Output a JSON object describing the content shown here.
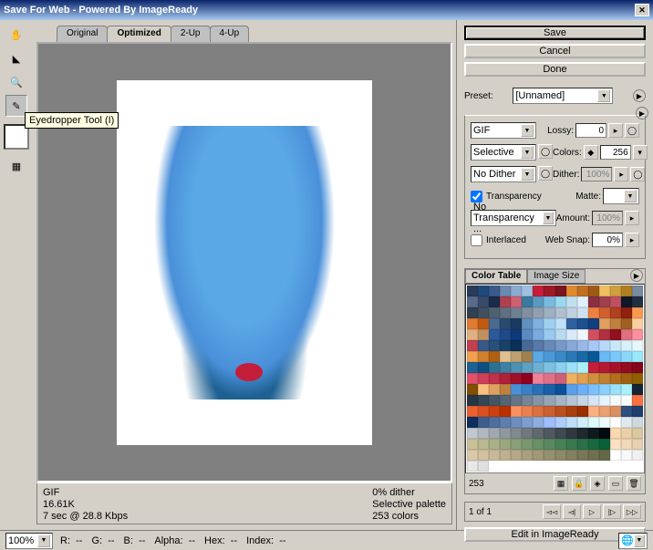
{
  "titlebar": {
    "title": "Save For Web - Powered By ImageReady"
  },
  "tabs": {
    "original": "Original",
    "optimized": "Optimized",
    "twoUp": "2-Up",
    "fourUp": "4-Up"
  },
  "tooltip": {
    "eyedropper": "Eyedropper Tool (I)"
  },
  "info": {
    "format": "GIF",
    "size": "16.61K",
    "timing": "7 sec @ 28.8 Kbps",
    "ditherText": "0% dither",
    "paletteText": "Selective palette",
    "colorsText": "253 colors"
  },
  "buttons": {
    "save": "Save",
    "cancel": "Cancel",
    "done": "Done",
    "editIR": "Edit in ImageReady"
  },
  "preset": {
    "label": "Preset:",
    "value": "[Unnamed]"
  },
  "settings": {
    "format": "GIF",
    "lossyLabel": "Lossy:",
    "lossy": "0",
    "reduction": "Selective",
    "colorsLabel": "Colors:",
    "colors": "256",
    "dither": "No Dither",
    "ditherLabel": "Dither:",
    "ditherPct": "100%",
    "transLabel": "Transparency",
    "matteLabel": "Matte:",
    "transDither": "No Transparency ...",
    "amountLabel": "Amount:",
    "amount": "100%",
    "interlacedLabel": "Interlaced",
    "webSnapLabel": "Web Snap:",
    "webSnap": "0%"
  },
  "colorTable": {
    "tab1": "Color Table",
    "tab2": "Image Size",
    "count": "253",
    "swatches": [
      "#2a3a5a",
      "#1e4a7a",
      "#3a5a8a",
      "#6a8ab0",
      "#8aaad0",
      "#a0c0e0",
      "#c41e3a",
      "#a01828",
      "#7a1420",
      "#e08a30",
      "#c07020",
      "#a05a18",
      "#f0c060",
      "#d0a040",
      "#b08020",
      "#7a8aa0",
      "#5a6a8a",
      "#3a4a6a",
      "#1a2a4a",
      "#b04050",
      "#d06070",
      "#3a7aa0",
      "#5a9ac0",
      "#7abae0",
      "#9adaf0",
      "#c0e0f0",
      "#e0f0fa",
      "#8a3040",
      "#a04050",
      "#c05060",
      "#101828",
      "#203040",
      "#304050",
      "#405060",
      "#506070",
      "#607080",
      "#708090",
      "#8090a0",
      "#90a0b0",
      "#a0b0c0",
      "#b0c0d0",
      "#c0d0e0",
      "#d0e0f0",
      "#f08040",
      "#d06030",
      "#b04020",
      "#902010",
      "#fa9a50",
      "#e07a30",
      "#c05a10",
      "#4a6a90",
      "#2a4a70",
      "#1a3a60",
      "#6090c0",
      "#80b0e0",
      "#a0d0f0",
      "#c0e0fa",
      "#3060a0",
      "#1e5090",
      "#104080",
      "#e0a060",
      "#c08040",
      "#a06020",
      "#fad0a0",
      "#e0b080",
      "#c09060",
      "#2a5a9a",
      "#1e4a8a",
      "#0e3a7a",
      "#5a8ac0",
      "#7aaae0",
      "#9acaf0",
      "#badaf0",
      "#daeafa",
      "#f0f5fa",
      "#d05060",
      "#b03040",
      "#901020",
      "#e07080",
      "#fa90a0",
      "#c04050",
      "#385888",
      "#285078",
      "#184068",
      "#083058",
      "#486898",
      "#5878a8",
      "#6888b8",
      "#7898c8",
      "#88a8d8",
      "#98b8e8",
      "#a8c8f8",
      "#b8d8fa",
      "#c8e8fa",
      "#d8f0fa",
      "#e8f8fa",
      "#f0a050",
      "#d08030",
      "#b06010",
      "#e0c090",
      "#c0a070",
      "#a08050",
      "#5aa9e6",
      "#4a99d6",
      "#3a89c6",
      "#2a79b6",
      "#1a69a6",
      "#0a5996",
      "#6ab9f6",
      "#7ac9fa",
      "#8ad9fa",
      "#9ae9fa",
      "#1e6091",
      "#0e5081",
      "#2e7091",
      "#3e80a1",
      "#4e90b1",
      "#5ea0c1",
      "#6eb0d1",
      "#7ec0e1",
      "#8ed0f1",
      "#9ee0fa",
      "#aef0fa",
      "#c41e3a",
      "#b41832",
      "#a4122a",
      "#940c22",
      "#84061a",
      "#e0506a",
      "#d0405a",
      "#c0304a",
      "#b0203a",
      "#a0102a",
      "#900020",
      "#f0809a",
      "#e0708a",
      "#d0607a",
      "#f0b060",
      "#e0a050",
      "#d09040",
      "#c08030",
      "#b07020",
      "#a06010",
      "#906000",
      "#805000",
      "#fac080",
      "#e0a060",
      "#c08040",
      "#4a90d9",
      "#3a80c9",
      "#2a70b9",
      "#1a60a9",
      "#0a5099",
      "#5aa0e9",
      "#6ab0f9",
      "#7ac0fa",
      "#8ad0fa",
      "#9ae0fa",
      "#aaf0fa",
      "#152535",
      "#253545",
      "#354555",
      "#455565",
      "#556575",
      "#657585",
      "#758595",
      "#8595a5",
      "#95a5b5",
      "#a5b5c5",
      "#b5c5d5",
      "#c5d5e5",
      "#d5e5f5",
      "#e5f5fa",
      "#f5fafa",
      "#fafafa",
      "#fa7040",
      "#ea6030",
      "#da5020",
      "#ca4010",
      "#ba3000",
      "#fa9060",
      "#ea8050",
      "#da7040",
      "#ca6030",
      "#ba5020",
      "#aa4010",
      "#9a3000",
      "#fab080",
      "#eaa070",
      "#da9060",
      "#2e4e7e",
      "#1e3e6e",
      "#0e2e5e",
      "#3e5e8e",
      "#4e6e9e",
      "#5e7eae",
      "#6e8ebe",
      "#7e9ece",
      "#8eaede",
      "#9ebefe",
      "#aecefa",
      "#bedefa",
      "#ceeefa",
      "#defafa",
      "#eefafa",
      "#ffffff",
      "#e0e8f0",
      "#d0d8e0",
      "#c0c8d0",
      "#b0b8c0",
      "#a0a8b0",
      "#9098a0",
      "#808890",
      "#707880",
      "#606870",
      "#505860",
      "#404850",
      "#303840",
      "#202830",
      "#101820",
      "#000810",
      "#fad8b0",
      "#ead0a8",
      "#dac8a0",
      "#cac098",
      "#bab890",
      "#aab088",
      "#9aa880",
      "#8aa078",
      "#7a9870",
      "#6a9068",
      "#5a8860",
      "#4a8058",
      "#3a7850",
      "#2a7048",
      "#1a6840",
      "#0a6038",
      "#fae0c0",
      "#f0d8b8",
      "#e6d0b0",
      "#dcc8a8",
      "#d2c0a0",
      "#c8b898",
      "#beb090",
      "#b4a888",
      "#aaa080",
      "#a09878",
      "#969070",
      "#8c8868",
      "#828060",
      "#787858",
      "#6e7050",
      "#646848",
      "#ffffff",
      "#f8f8f8",
      "#f0f0f0",
      "#e8e8e8",
      "#e0e0e0"
    ]
  },
  "pager": {
    "text": "1 of 1"
  },
  "zoom": {
    "value": "100%"
  },
  "readouts": {
    "r": "R:",
    "g": "G:",
    "b": "B:",
    "alpha": "Alpha:",
    "hex": "Hex:",
    "index": "Index:",
    "dash": "--"
  }
}
